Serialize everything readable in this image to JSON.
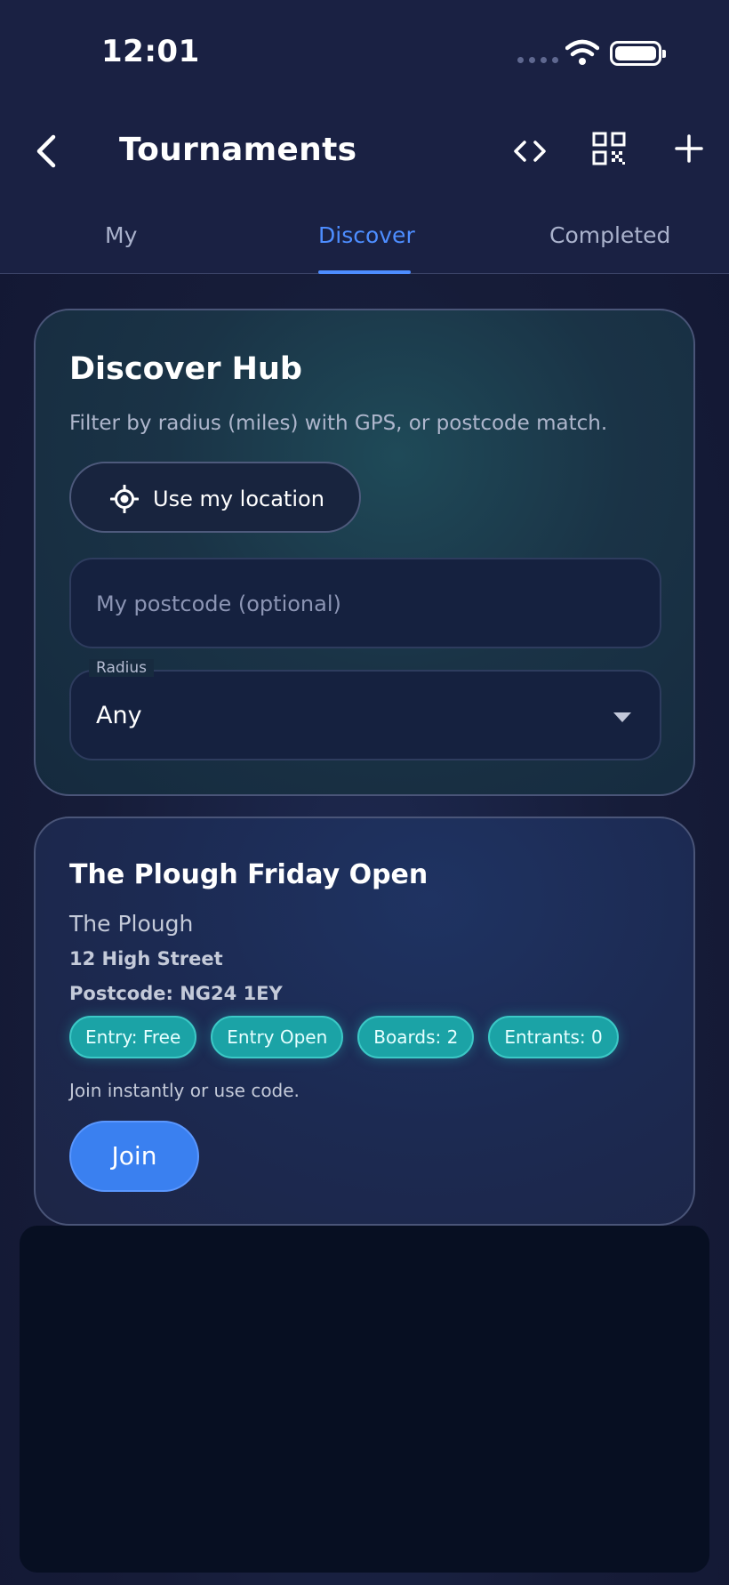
{
  "status_bar": {
    "time": "12:01"
  },
  "header": {
    "title": "Tournaments",
    "icons": [
      "back-icon",
      "code-icon",
      "qr-code-icon",
      "plus-icon"
    ]
  },
  "tabs": [
    {
      "label": "My",
      "active": false
    },
    {
      "label": "Discover",
      "active": true
    },
    {
      "label": "Completed",
      "active": false
    }
  ],
  "discover_hub": {
    "title": "Discover Hub",
    "subtitle": "Filter by radius (miles) with GPS, or postcode match.",
    "location_button": {
      "label": "Use my location",
      "icon": "crosshair-icon"
    },
    "postcode_field": {
      "placeholder": "My postcode (optional)",
      "value": ""
    },
    "radius_select": {
      "label": "Radius",
      "value": "Any"
    }
  },
  "tournament": {
    "name": "The Plough Friday Open",
    "venue": "The Plough",
    "address": "12 High Street",
    "postcode": "Postcode: NG24 1EY",
    "chips": [
      "Entry: Free",
      "Entry Open",
      "Boards: 2",
      "Entrants: 0"
    ],
    "hint": "Join instantly or use code.",
    "join_label": "Join"
  },
  "colors": {
    "accent": "#4d8dff",
    "chip": "#1ba3a6",
    "join_button": "#3a80f0",
    "background": "#1a2143"
  }
}
